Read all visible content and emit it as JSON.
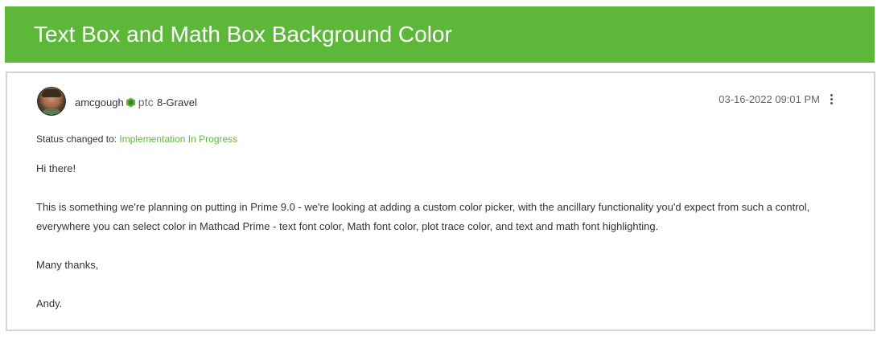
{
  "header": {
    "title": "Text Box and Math Box Background Color"
  },
  "post": {
    "author": "amcgough",
    "badge_icon": "ptc-hexagon-icon",
    "company": "ptc",
    "rank": "8-Gravel",
    "timestamp": "03-16-2022 09:01 PM",
    "menu_icon": "more-vertical-icon",
    "status_label": "Status changed to:",
    "status_value": "Implementation In Progress",
    "body": {
      "greeting": "Hi there!",
      "paragraph": "This is something we're planning on putting in Prime 9.0 - we're looking at adding a custom color picker, with the ancillary functionality you'd expect from such a control, everywhere you can select color in Mathcad Prime - text font color, Math font color, plot trace color, and text and math font highlighting.",
      "thanks": "Many thanks,",
      "signature": "Andy."
    }
  },
  "colors": {
    "brand_green": "#5db83a",
    "border": "#d4d4d4",
    "text": "#333333"
  }
}
